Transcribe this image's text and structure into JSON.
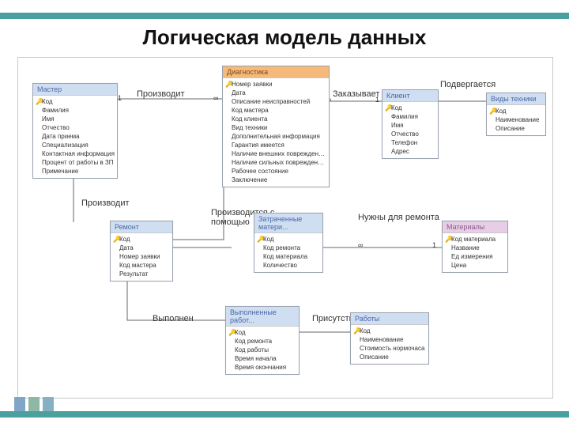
{
  "title": "Логическая модель данных",
  "relations": {
    "produces1": "Производит",
    "orders": "Заказывает",
    "subject_to": "Подвергается",
    "produces2": "Производит",
    "with_help": "Производится с помощью",
    "spent_mat": "Затраченные матери...",
    "needed": "Нужны для ремонта",
    "done": "Выполнен",
    "done_work": "Выполненные работ...",
    "present": "Присутствуют"
  },
  "entities": {
    "master": {
      "title": "Мастер",
      "fields": [
        {
          "k": "1",
          "n": "Код"
        },
        {
          "k": "",
          "n": "Фамилия"
        },
        {
          "k": "",
          "n": "Имя"
        },
        {
          "k": "",
          "n": "Отчество"
        },
        {
          "k": "",
          "n": "Дата приема"
        },
        {
          "k": "",
          "n": "Специализация"
        },
        {
          "k": "",
          "n": "Контактная информация"
        },
        {
          "k": "",
          "n": "Процент от работы в ЗП"
        },
        {
          "k": "",
          "n": "Примечание"
        }
      ]
    },
    "diag": {
      "title": "Диагностика",
      "fields": [
        {
          "k": "1",
          "n": "Номер заявки"
        },
        {
          "k": "",
          "n": "Дата"
        },
        {
          "k": "",
          "n": "Описание неисправностей"
        },
        {
          "k": "",
          "n": "Код мастера"
        },
        {
          "k": "",
          "n": "Код клиента"
        },
        {
          "k": "",
          "n": "Вид техники"
        },
        {
          "k": "",
          "n": "Дополнительная информация"
        },
        {
          "k": "",
          "n": "Гарантия имеется"
        },
        {
          "k": "",
          "n": "Наличие внешних повреждений на корпусе"
        },
        {
          "k": "",
          "n": "Наличие сильных повреждений на корпусе"
        },
        {
          "k": "",
          "n": "Рабочее состояние"
        },
        {
          "k": "",
          "n": "Заключение"
        }
      ]
    },
    "client": {
      "title": "Клиент",
      "fields": [
        {
          "k": "1",
          "n": "Код"
        },
        {
          "k": "",
          "n": "Фамилия"
        },
        {
          "k": "",
          "n": "Имя"
        },
        {
          "k": "",
          "n": "Отчество"
        },
        {
          "k": "",
          "n": "Телефон"
        },
        {
          "k": "",
          "n": "Адрес"
        }
      ]
    },
    "tech": {
      "title": "Виды техники",
      "fields": [
        {
          "k": "1",
          "n": "Код"
        },
        {
          "k": "",
          "n": "Наименование"
        },
        {
          "k": "",
          "n": "Описание"
        }
      ]
    },
    "repair": {
      "title": "Ремонт",
      "fields": [
        {
          "k": "1",
          "n": "Код"
        },
        {
          "k": "",
          "n": "Дата"
        },
        {
          "k": "",
          "n": "Номер заявки"
        },
        {
          "k": "",
          "n": "Код мастера"
        },
        {
          "k": "",
          "n": "Результат"
        }
      ]
    },
    "spent": {
      "title": "Затраченные матери...",
      "fields": [
        {
          "k": "1",
          "n": "Код"
        },
        {
          "k": "",
          "n": "Код ремонта"
        },
        {
          "k": "",
          "n": "Код материала"
        },
        {
          "k": "",
          "n": "Количество"
        }
      ]
    },
    "materials": {
      "title": "Материалы",
      "fields": [
        {
          "k": "1",
          "n": "Код материала"
        },
        {
          "k": "",
          "n": "Название"
        },
        {
          "k": "",
          "n": "Ед измерения"
        },
        {
          "k": "",
          "n": "Цена"
        }
      ]
    },
    "donework": {
      "title": "Выполненные работ...",
      "fields": [
        {
          "k": "1",
          "n": "Код"
        },
        {
          "k": "",
          "n": "Код ремонта"
        },
        {
          "k": "",
          "n": "Код работы"
        },
        {
          "k": "",
          "n": "Время начала"
        },
        {
          "k": "",
          "n": "Время окончания"
        }
      ]
    },
    "works": {
      "title": "Работы",
      "fields": [
        {
          "k": "1",
          "n": "Код"
        },
        {
          "k": "",
          "n": "Наименование"
        },
        {
          "k": "",
          "n": "Стоимость нормочаса"
        },
        {
          "k": "",
          "n": "Описание"
        }
      ]
    }
  },
  "symbols": {
    "inf": "∞",
    "one": "1",
    "key": "🔑"
  }
}
